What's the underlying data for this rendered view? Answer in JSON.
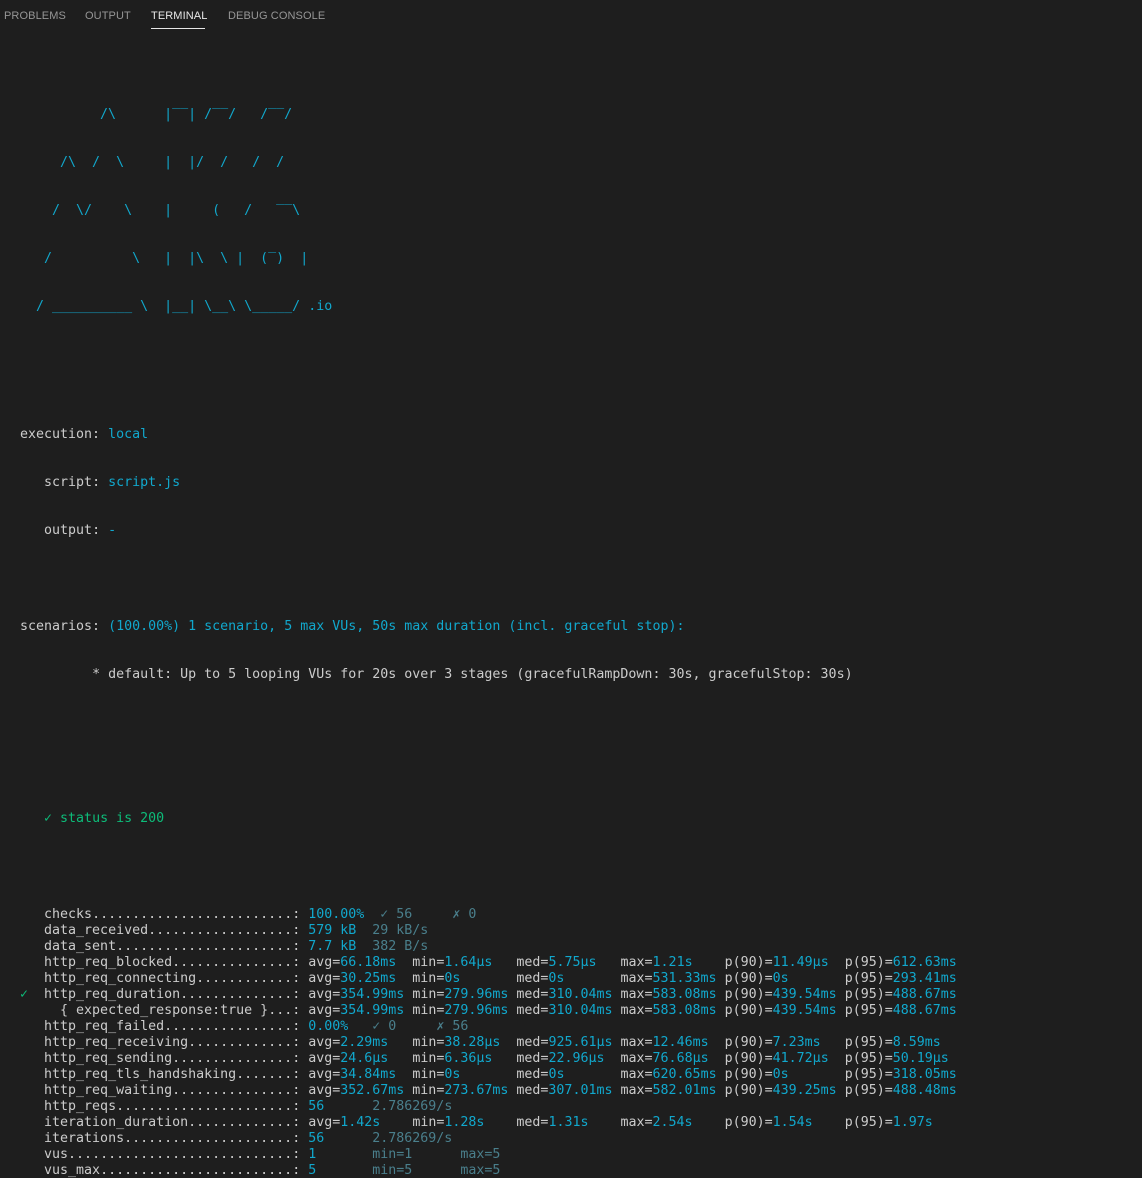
{
  "tabs": [
    {
      "label": "PROBLEMS"
    },
    {
      "label": "OUTPUT"
    },
    {
      "label": "TERMINAL"
    },
    {
      "label": "DEBUG CONSOLE"
    }
  ],
  "active_tab": "TERMINAL",
  "logo_lines": [
    "          /\\      |‾‾| /‾‾/   /‾‾/",
    "     /\\  /  \\     |  |/  /   /  /",
    "    /  \\/    \\    |     (   /   ‾‾\\",
    "   /          \\   |  |\\  \\ |  (‾)  |",
    "  / __________ \\  |__| \\__\\ \\_____/ .io"
  ],
  "execution": {
    "label": "execution:",
    "value": "local"
  },
  "script": {
    "label": "script:",
    "value": "script.js"
  },
  "output": {
    "label": "output:",
    "value": "-"
  },
  "scenarios": {
    "label": "scenarios:",
    "summary": "(100.00%) 1 scenario, 5 max VUs, 50s max duration (incl. graceful stop):",
    "detail": "* default: Up to 5 looping VUs for 20s over 3 stages (gracefulRampDown: 30s, gracefulStop: 30s)"
  },
  "check": "✓ status is 200",
  "metrics": [
    {
      "mark": "",
      "name": "checks",
      "dots": ".........................:",
      "cols": [
        [
          "100.00%",
          "cyan"
        ],
        [
          "✓ 56",
          "dim"
        ],
        [
          "✗ 0",
          "dim"
        ]
      ],
      "widths": [
        9,
        9,
        0
      ]
    },
    {
      "mark": "",
      "name": "data_received",
      "dots": "..................:",
      "cols": [
        [
          "579 kB",
          "cyan"
        ],
        [
          "29 kB/s",
          "dim"
        ]
      ],
      "widths": [
        8,
        0
      ]
    },
    {
      "mark": "",
      "name": "data_sent",
      "dots": "......................:",
      "cols": [
        [
          "7.7 kB",
          "cyan"
        ],
        [
          "382 B/s",
          "dim"
        ]
      ],
      "widths": [
        8,
        0
      ]
    },
    {
      "mark": "",
      "name": "http_req_blocked",
      "dots": "...............:",
      "stats": [
        "66.18ms",
        "1.64µs",
        "5.75µs",
        "1.21s",
        "11.49µs",
        "612.63ms"
      ]
    },
    {
      "mark": "",
      "name": "http_req_connecting",
      "dots": "............:",
      "stats": [
        "30.25ms",
        "0s",
        "0s",
        "531.33ms",
        "0s",
        "293.41ms"
      ]
    },
    {
      "mark": "✓",
      "name": "http_req_duration",
      "dots": "..............:",
      "stats": [
        "354.99ms",
        "279.96ms",
        "310.04ms",
        "583.08ms",
        "439.54ms",
        "488.67ms"
      ]
    },
    {
      "mark": "",
      "name": "  { expected_response:true }",
      "dots": "...:",
      "stats": [
        "354.99ms",
        "279.96ms",
        "310.04ms",
        "583.08ms",
        "439.54ms",
        "488.67ms"
      ]
    },
    {
      "mark": "",
      "name": "http_req_failed",
      "dots": "................:",
      "cols": [
        [
          "0.00%",
          "cyan"
        ],
        [
          "✓ 0",
          "dim"
        ],
        [
          "✗ 56",
          "dim"
        ]
      ],
      "widths": [
        8,
        8,
        0
      ]
    },
    {
      "mark": "",
      "name": "http_req_receiving",
      "dots": ".............:",
      "stats": [
        "2.29ms",
        "38.28µs",
        "925.61µs",
        "12.46ms",
        "7.23ms",
        "8.59ms"
      ]
    },
    {
      "mark": "",
      "name": "http_req_sending",
      "dots": "...............:",
      "stats": [
        "24.6µs",
        "6.36µs",
        "22.96µs",
        "76.68µs",
        "41.72µs",
        "50.19µs"
      ]
    },
    {
      "mark": "",
      "name": "http_req_tls_handshaking",
      "dots": ".......:",
      "stats": [
        "34.84ms",
        "0s",
        "0s",
        "620.65ms",
        "0s",
        "318.05ms"
      ]
    },
    {
      "mark": "",
      "name": "http_req_waiting",
      "dots": "...............:",
      "stats": [
        "352.67ms",
        "273.67ms",
        "307.01ms",
        "582.01ms",
        "439.25ms",
        "488.48ms"
      ]
    },
    {
      "mark": "",
      "name": "http_reqs",
      "dots": "......................:",
      "cols": [
        [
          "56",
          "cyan"
        ],
        [
          "2.786269/s",
          "dim"
        ]
      ],
      "widths": [
        8,
        0
      ]
    },
    {
      "mark": "",
      "name": "iteration_duration",
      "dots": ".............:",
      "stats": [
        "1.42s",
        "1.28s",
        "1.31s",
        "2.54s",
        "1.54s",
        "1.97s"
      ]
    },
    {
      "mark": "",
      "name": "iterations",
      "dots": ".....................:",
      "cols": [
        [
          "56",
          "cyan"
        ],
        [
          "2.786269/s",
          "dim"
        ]
      ],
      "widths": [
        8,
        0
      ]
    },
    {
      "mark": "",
      "name": "vus",
      "dots": "............................:",
      "cols": [
        [
          "1",
          "cyan"
        ],
        [
          "min=1",
          "dim"
        ],
        [
          "max=5",
          "dim"
        ]
      ],
      "widths": [
        8,
        11,
        0
      ]
    },
    {
      "mark": "",
      "name": "vus_max",
      "dots": "........................:",
      "cols": [
        [
          "5",
          "cyan"
        ],
        [
          "min=5",
          "dim"
        ],
        [
          "max=5",
          "dim"
        ]
      ],
      "widths": [
        8,
        11,
        0
      ]
    }
  ],
  "stat_labels": [
    "avg=",
    "min=",
    "med=",
    "max=",
    "p(90)=",
    "p(95)="
  ],
  "colors": {
    "background": "#1e1e1e",
    "text": "#cccccc",
    "accent": "#11a8cd",
    "success": "#0dbc79",
    "muted": "#4a7f8c"
  }
}
